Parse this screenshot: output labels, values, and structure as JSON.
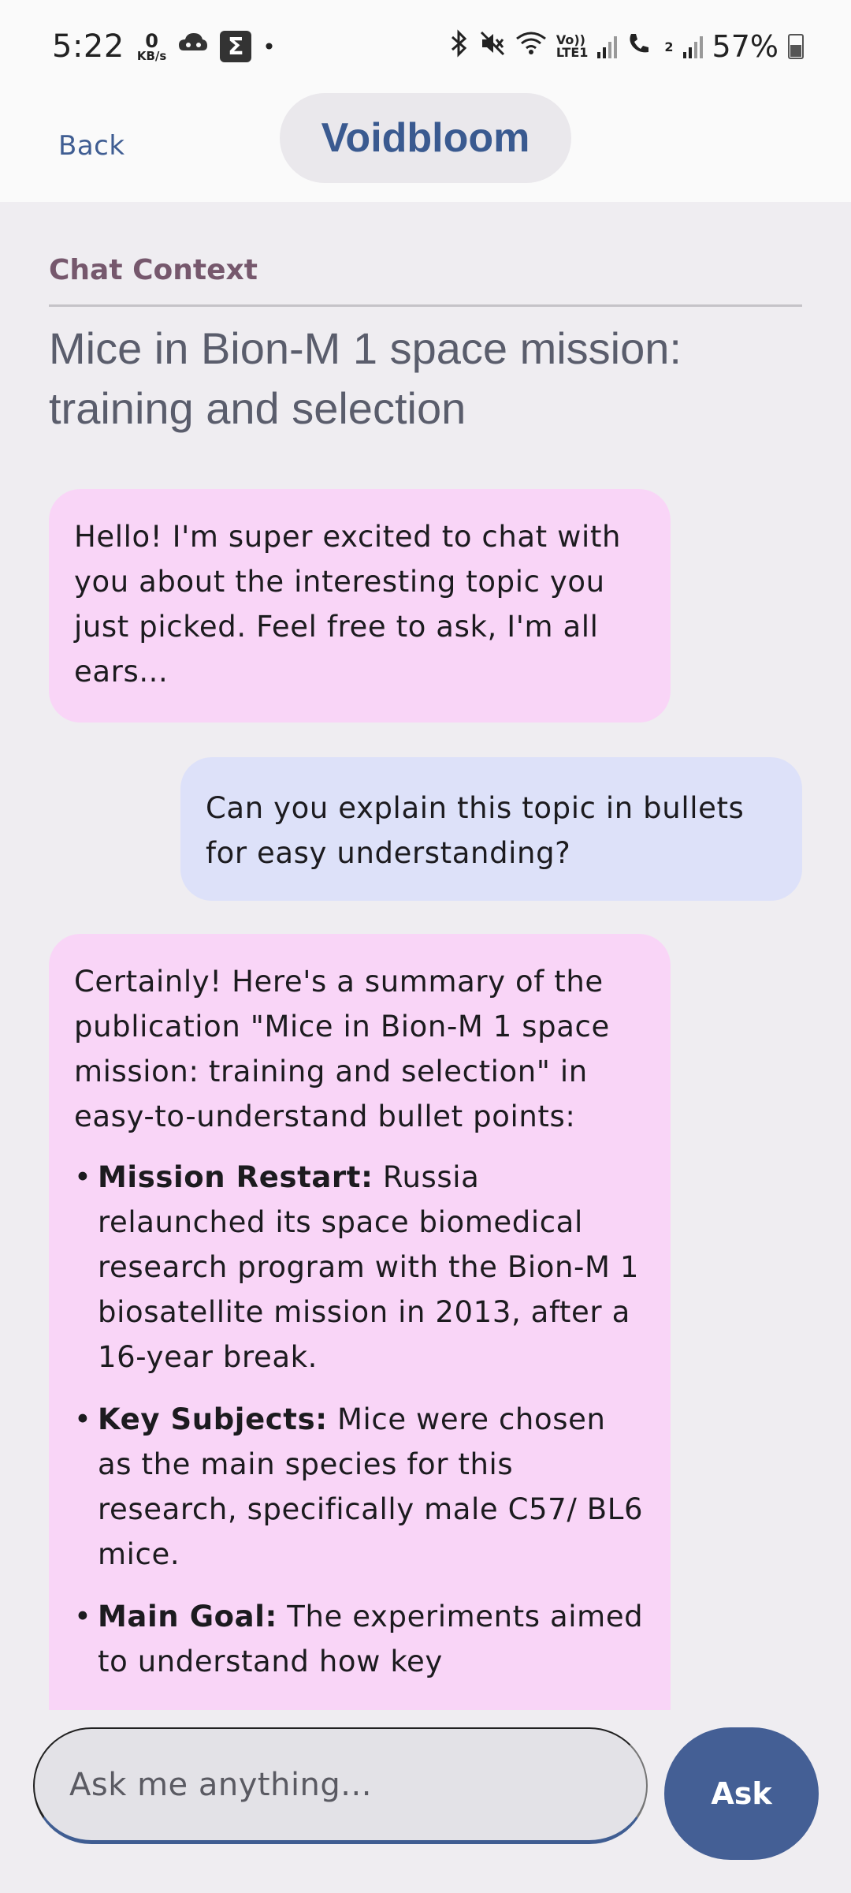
{
  "status_bar": {
    "time": "5:22",
    "net_speed_value": "0",
    "net_speed_unit": "KB/s",
    "sigma_glyph": "Σ",
    "notification_dot": "•",
    "volte_top": "Vo))",
    "volte_bottom": "LTE1",
    "sim2_label": "2",
    "battery_percent": "57%",
    "icons": [
      "cloud-game-icon",
      "sigma-app-icon",
      "bluetooth-icon",
      "mute-icon",
      "wifi-icon",
      "signal-icon",
      "wifi-call-icon",
      "battery-icon"
    ]
  },
  "app_bar": {
    "back_label": "Back",
    "title": "Voidbloom"
  },
  "context": {
    "label": "Chat Context",
    "title": "Mice in Bion-M 1 space mission: training and selection"
  },
  "messages": [
    {
      "role": "bot",
      "text": "Hello! I'm super excited to chat with you about the interesting topic you just picked. Feel free to ask, I'm all ears..."
    },
    {
      "role": "user",
      "text": "Can you explain this topic in bullets for easy understanding?"
    },
    {
      "role": "bot",
      "intro": "Certainly! Here's a summary of the publication \"Mice in Bion-M 1 space mission: training and selection\" in easy-to-understand bullet points:",
      "bullets": [
        {
          "heading": "Mission Restart:",
          "text": " Russia relaunched its space biomedical research program with the Bion-M 1 biosatellite mission in 2013, after a 16-year break."
        },
        {
          "heading": "Key Subjects:",
          "text": " Mice were chosen as the main species for this research, specifically male C57/ BL6 mice."
        },
        {
          "heading": "Main Goal:",
          "text": " The experiments aimed to understand how key"
        }
      ]
    }
  ],
  "composer": {
    "placeholder": "Ask me anything...",
    "value": "",
    "send_label": "Ask"
  }
}
